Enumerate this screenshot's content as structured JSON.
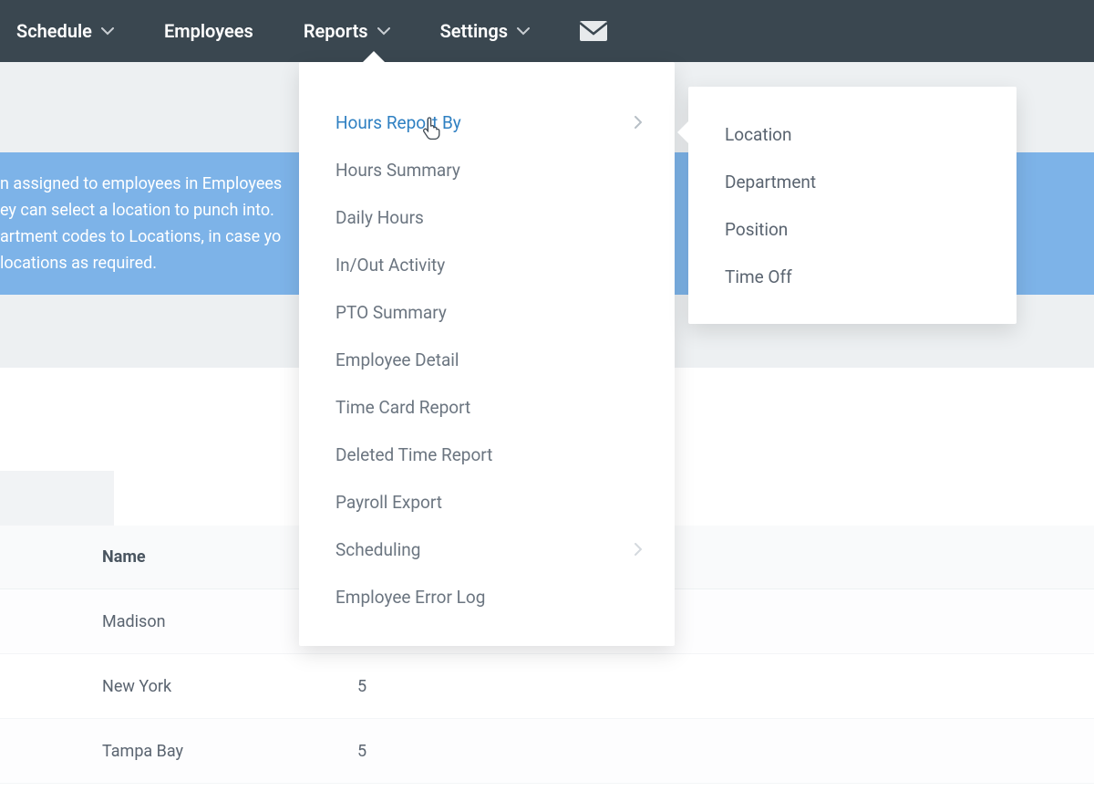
{
  "nav": {
    "schedule": "Schedule",
    "employees": "Employees",
    "reports": "Reports",
    "settings": "Settings"
  },
  "infoBanner": {
    "line1": "n assigned to employees in Employees",
    "line2": "ey can select a location to punch into.",
    "line3": "artment codes to Locations, in case yo",
    "line4": "locations as required."
  },
  "reportsMenu": {
    "items": [
      {
        "label": "Hours Report By",
        "hasSub": true,
        "active": true
      },
      {
        "label": "Hours Summary"
      },
      {
        "label": "Daily Hours"
      },
      {
        "label": "In/Out Activity"
      },
      {
        "label": "PTO Summary"
      },
      {
        "label": "Employee Detail"
      },
      {
        "label": "Time Card Report"
      },
      {
        "label": "Deleted Time Report"
      },
      {
        "label": "Payroll Export"
      },
      {
        "label": "Scheduling",
        "hasSub": true
      },
      {
        "label": "Employee Error Log"
      }
    ]
  },
  "hoursReportBySub": {
    "items": [
      {
        "label": "Location"
      },
      {
        "label": "Department"
      },
      {
        "label": "Position"
      },
      {
        "label": "Time Off"
      }
    ]
  },
  "table": {
    "header": {
      "name": "Name"
    },
    "rows": [
      {
        "name": "Madison",
        "value": ""
      },
      {
        "name": "New York",
        "value": "5"
      },
      {
        "name": "Tampa Bay",
        "value": "5"
      }
    ]
  }
}
